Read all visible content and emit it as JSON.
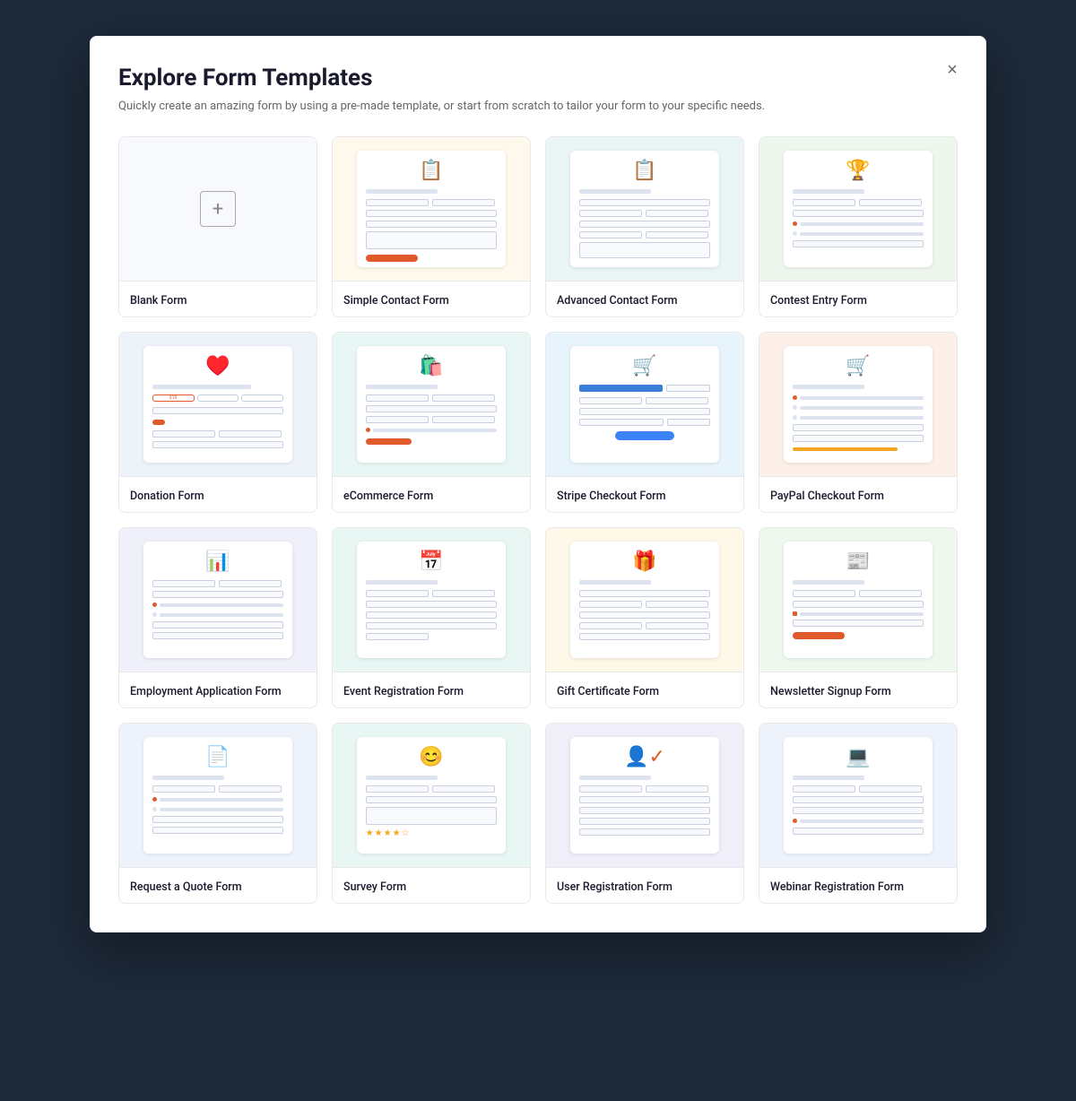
{
  "modal": {
    "title": "Explore Form Templates",
    "subtitle": "Quickly create an amazing form by using a pre-made template, or start from scratch to tailor your form to your specific needs.",
    "close_label": "×"
  },
  "templates": [
    {
      "id": "blank",
      "name": "Blank Form",
      "bg": "blank",
      "icon": null
    },
    {
      "id": "simple-contact",
      "name": "Simple Contact Form",
      "bg": "yellow",
      "icon": "📋"
    },
    {
      "id": "advanced-contact",
      "name": "Advanced Contact Form",
      "bg": "teal",
      "icon": "📋"
    },
    {
      "id": "contest-entry",
      "name": "Contest Entry Form",
      "bg": "green",
      "icon": "🏆"
    },
    {
      "id": "donation",
      "name": "Donation Form",
      "bg": "blue-light",
      "icon": "❤️"
    },
    {
      "id": "ecommerce",
      "name": "eCommerce Form",
      "bg": "mint",
      "icon": "🛍️"
    },
    {
      "id": "stripe-checkout",
      "name": "Stripe Checkout Form",
      "bg": "sky",
      "icon": "🛒"
    },
    {
      "id": "paypal-checkout",
      "name": "PayPal Checkout Form",
      "bg": "peach",
      "icon": "🛒"
    },
    {
      "id": "employment-application",
      "name": "Employment Application Form",
      "bg": "lavender",
      "icon": "📊"
    },
    {
      "id": "event-registration",
      "name": "Event Registration Form",
      "bg": "pale-teal",
      "icon": "📅"
    },
    {
      "id": "gift-certificate",
      "name": "Gift Certificate Form",
      "bg": "pale-yellow",
      "icon": "🎁"
    },
    {
      "id": "newsletter-signup",
      "name": "Newsletter Signup Form",
      "bg": "pale-green",
      "icon": "📰"
    },
    {
      "id": "request-quote",
      "name": "Request a Quote Form",
      "bg": "pale-blue",
      "icon": "📄"
    },
    {
      "id": "survey",
      "name": "Survey Form",
      "bg": "pale-teal",
      "icon": "😊"
    },
    {
      "id": "user-registration",
      "name": "User Registration Form",
      "bg": "pale-lavender",
      "icon": "👤"
    },
    {
      "id": "webinar-registration",
      "name": "Webinar Registration Form",
      "bg": "pale-blue",
      "icon": "💻"
    }
  ]
}
